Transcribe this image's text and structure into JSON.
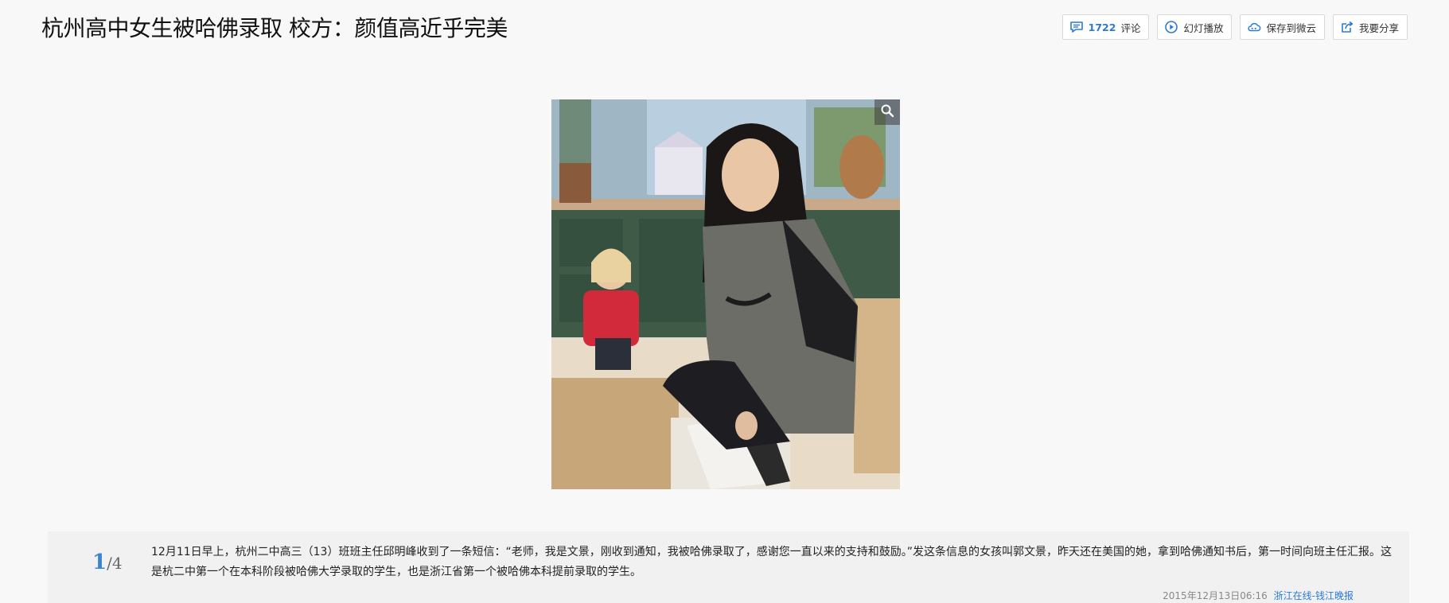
{
  "header": {
    "title": "杭州高中女生被哈佛录取 校方：颜值高近乎完美"
  },
  "toolbar": {
    "comments": {
      "count": "1722",
      "label": "评论",
      "icon": "comment-icon"
    },
    "slideshow": {
      "label": "幻灯播放",
      "icon": "play-circle-icon"
    },
    "save_to_cloud": {
      "label": "保存到微云",
      "icon": "cloud-icon"
    },
    "share": {
      "label": "我要分享",
      "icon": "share-icon"
    },
    "colors": {
      "accent": "#2a7bd6"
    }
  },
  "image": {
    "icon": "magnifier-icon"
  },
  "caption": {
    "page_current": "1",
    "page_separator": "/",
    "page_total": "4",
    "text": "12月11日早上，杭州二中高三（13）班班主任邱明峰收到了一条短信：“老师，我是文景，刚收到通知，我被哈佛录取了，感谢您一直以来的支持和鼓励。”发这条信息的女孩叫郭文景，昨天还在美国的她，拿到哈佛通知书后，第一时间向班主任汇报。这是杭二中第一个在本科阶段被哈佛大学录取的学生，也是浙江省第一个被哈佛本科提前录取的学生。",
    "date": "2015年12月13日06:16",
    "source": "浙江在线-钱江晚报"
  }
}
